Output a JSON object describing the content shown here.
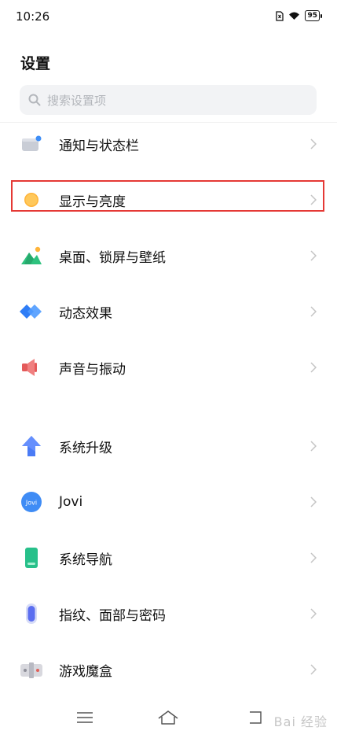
{
  "status": {
    "time": "10:26",
    "battery": "95"
  },
  "title": "设置",
  "search": {
    "placeholder": "搜索设置项"
  },
  "items": [
    {
      "label": "通知与状态栏",
      "icon": "notification-icon"
    },
    {
      "label": "显示与亮度",
      "icon": "brightness-icon",
      "highlighted": true
    },
    {
      "label": "桌面、锁屏与壁纸",
      "icon": "wallpaper-icon"
    },
    {
      "label": "动态效果",
      "icon": "animation-icon"
    },
    {
      "label": "声音与振动",
      "icon": "sound-icon"
    },
    {
      "label": "系统升级",
      "icon": "upgrade-icon"
    },
    {
      "label": "Jovi",
      "icon": "jovi-icon",
      "badge": "Jovi"
    },
    {
      "label": "系统导航",
      "icon": "navigation-icon"
    },
    {
      "label": "指纹、面部与密码",
      "icon": "fingerprint-icon"
    },
    {
      "label": "游戏魔盒",
      "icon": "game-box-icon"
    }
  ],
  "colors": {
    "highlight": "#e53935",
    "accent": "#4a8df8"
  },
  "watermark": "Bai 经验"
}
